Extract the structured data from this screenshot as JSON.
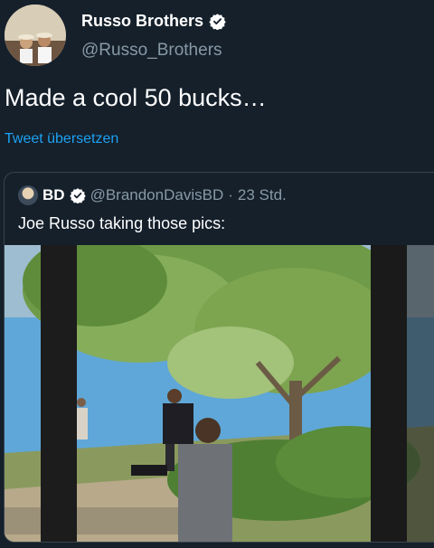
{
  "author": {
    "display_name": "Russo Brothers",
    "handle": "@Russo_Brothers",
    "avatar_icon": "profile-avatar"
  },
  "tweet": {
    "text": "Made a cool 50 bucks…",
    "translate_label": "Tweet übersetzen"
  },
  "quoted_tweet": {
    "display_name": "BD",
    "handle": "@BrandonDavisBD",
    "separator": "·",
    "time": "23 Std.",
    "text": "Joe Russo taking those pics:"
  },
  "colors": {
    "background": "#15202b",
    "secondary_text": "#8899a6",
    "link": "#1da1f2",
    "border": "#38444d"
  }
}
